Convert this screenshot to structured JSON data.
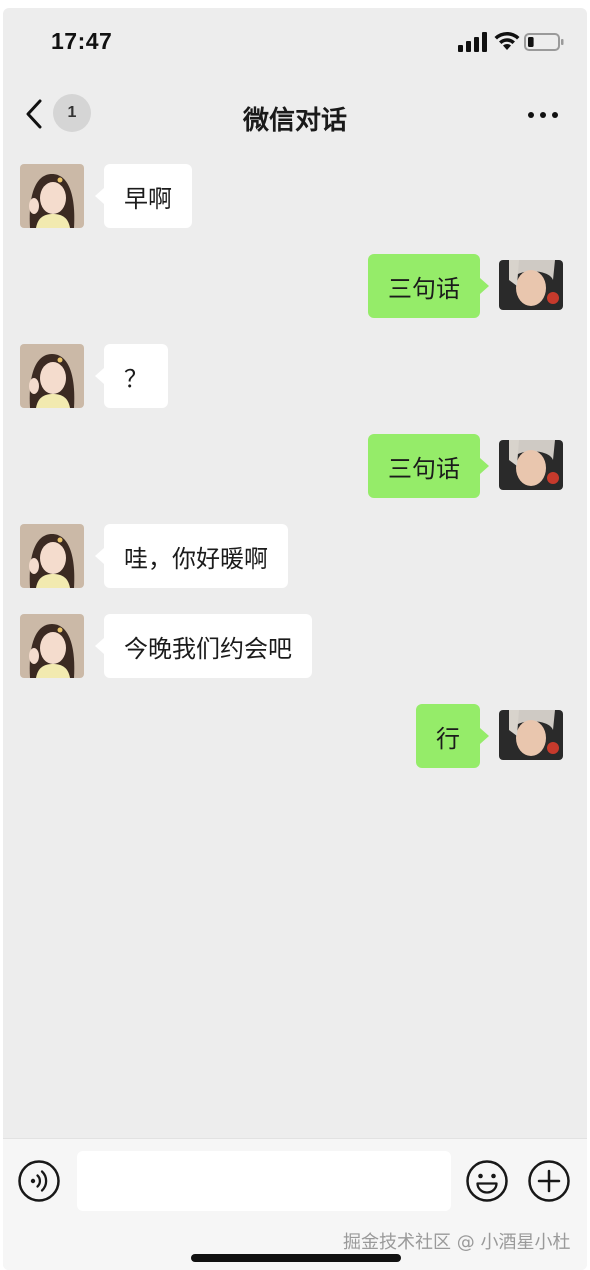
{
  "status_bar": {
    "time": "17:47",
    "signal_icon": "cellular-signal-icon",
    "wifi_icon": "wifi-icon",
    "battery_icon": "battery-low-icon",
    "battery_level": 0.2
  },
  "nav": {
    "back_icon": "chevron-left-icon",
    "unread_badge": "1",
    "title": "微信对话",
    "more_icon": "ellipsis-icon"
  },
  "colors": {
    "background": "#ededed",
    "incoming_bubble": "#ffffff",
    "outgoing_bubble": "#95ec69",
    "text": "#1b1b1b"
  },
  "messages": [
    {
      "side": "left",
      "text": "早啊"
    },
    {
      "side": "right",
      "text": "三句话"
    },
    {
      "side": "left",
      "text": "？"
    },
    {
      "side": "right",
      "text": "三句话"
    },
    {
      "side": "left",
      "text": "哇，你好暖啊"
    },
    {
      "side": "left",
      "text": "今晚我们约会吧"
    },
    {
      "side": "right",
      "text": "行"
    }
  ],
  "input_bar": {
    "voice_icon": "voice-icon",
    "input_value": "",
    "emoji_icon": "emoji-icon",
    "plus_icon": "plus-icon"
  },
  "watermark": "掘金技术社区 @ 小酒星小杜"
}
